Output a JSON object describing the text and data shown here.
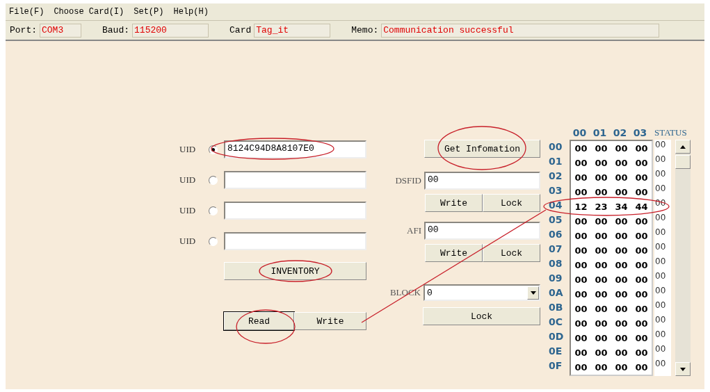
{
  "menu": [
    {
      "label": "File(F)"
    },
    {
      "label": "Choose Card(I)"
    },
    {
      "label": "Set(P)"
    },
    {
      "label": "Help(H)"
    }
  ],
  "status_bar": [
    {
      "label": "Port:",
      "value": "COM3"
    },
    {
      "label": "Baud:",
      "value": "115200"
    },
    {
      "label": "Card",
      "value": "Tag_it"
    },
    {
      "label": "Memo:",
      "value": "Communication successful"
    }
  ],
  "uids": [
    {
      "label": "UID",
      "selected": true,
      "value": "8124C94D8A8107E0"
    },
    {
      "label": "UID",
      "selected": false
    },
    {
      "label": "UID",
      "selected": false
    },
    {
      "label": "UID",
      "selected": false
    }
  ],
  "inventory_button": "INVENTORY",
  "read_button": "Read",
  "write_button": "Write",
  "get_info_button": "Get Infomation",
  "dsfid": {
    "label": "DSFID",
    "value": "00",
    "buttons": [
      "Write",
      "Lock"
    ]
  },
  "afi": {
    "label": "AFI",
    "value": "00",
    "buttons": [
      "Write",
      "Lock"
    ]
  },
  "block": {
    "label": "BLOCK",
    "value": "0"
  },
  "block_lock_button": "Lock",
  "table": {
    "columns": [
      "00",
      "01",
      "02",
      "03"
    ],
    "status_header": "STATUS",
    "rows": [
      {
        "address": "00",
        "bytes": [
          "00",
          "00",
          "00",
          "00"
        ],
        "status": "00"
      },
      {
        "address": "01",
        "bytes": [
          "00",
          "00",
          "00",
          "00"
        ],
        "status": "00"
      },
      {
        "address": "02",
        "bytes": [
          "00",
          "00",
          "00",
          "00"
        ],
        "status": "00"
      },
      {
        "address": "03",
        "bytes": [
          "00",
          "00",
          "00",
          "00"
        ],
        "status": "00"
      },
      {
        "address": "04",
        "bytes": [
          "12",
          "23",
          "34",
          "44"
        ],
        "status": "00"
      },
      {
        "address": "05",
        "bytes": [
          "00",
          "00",
          "00",
          "00"
        ],
        "status": "00"
      },
      {
        "address": "06",
        "bytes": [
          "00",
          "00",
          "00",
          "00"
        ],
        "status": "00"
      },
      {
        "address": "07",
        "bytes": [
          "00",
          "00",
          "00",
          "00"
        ],
        "status": "00"
      },
      {
        "address": "08",
        "bytes": [
          "00",
          "00",
          "00",
          "00"
        ],
        "status": "00"
      },
      {
        "address": "09",
        "bytes": [
          "00",
          "00",
          "00",
          "00"
        ],
        "status": "00"
      },
      {
        "address": "0A",
        "bytes": [
          "00",
          "00",
          "00",
          "00"
        ],
        "status": "00"
      },
      {
        "address": "0B",
        "bytes": [
          "00",
          "00",
          "00",
          "00"
        ],
        "status": "00"
      },
      {
        "address": "0C",
        "bytes": [
          "00",
          "00",
          "00",
          "00"
        ],
        "status": "00"
      },
      {
        "address": "0D",
        "bytes": [
          "00",
          "00",
          "00",
          "00"
        ],
        "status": "00"
      },
      {
        "address": "0E",
        "bytes": [
          "00",
          "00",
          "00",
          "00"
        ],
        "status": "00"
      },
      {
        "address": "0F",
        "bytes": [
          "00",
          "00",
          "00",
          "00"
        ],
        "status": "00"
      }
    ]
  }
}
